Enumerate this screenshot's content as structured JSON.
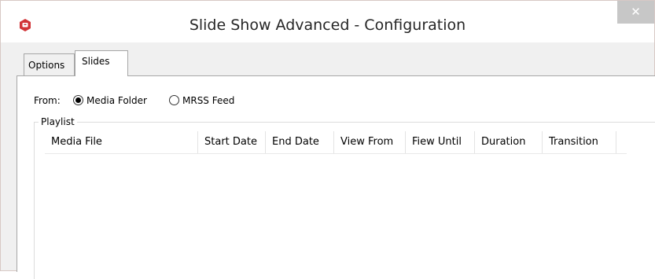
{
  "window": {
    "title": "Slide Show Advanced - Configuration",
    "close_glyph": "✕",
    "app_icon": "app-icon",
    "app_icon_color": "#d13438"
  },
  "tabs": [
    {
      "label": "Options",
      "selected": false
    },
    {
      "label": "Slides",
      "selected": true
    }
  ],
  "from": {
    "label": "From:",
    "options": [
      {
        "label": "Media Folder",
        "selected": true
      },
      {
        "label": "MRSS Feed",
        "selected": false
      }
    ]
  },
  "playlist": {
    "legend": "Playlist",
    "columns": [
      "Media File",
      "Start Date",
      "End Date",
      "View From",
      "Fiew Until",
      "Duration",
      "Transition"
    ],
    "rows": []
  }
}
